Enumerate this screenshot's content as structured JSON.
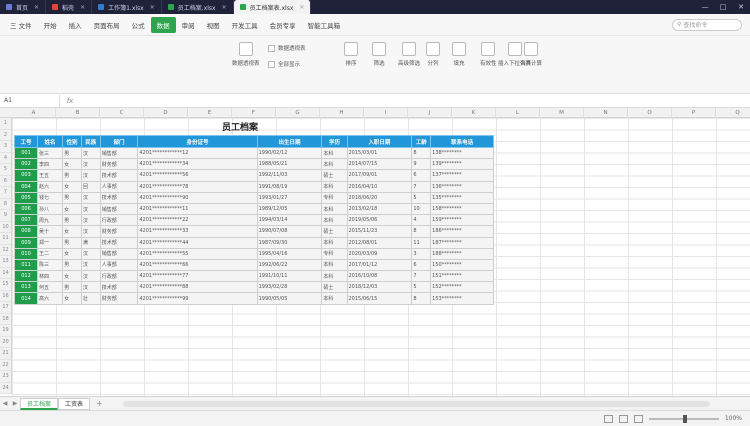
{
  "tabs": [
    {
      "label": "首页",
      "color": "#6b7bd6"
    },
    {
      "label": "稻壳",
      "color": "#e0463a"
    },
    {
      "label": "工作簿1.xlsx",
      "color": "#2b7cd3"
    },
    {
      "label": "员工档案.xlsx",
      "color": "#2ea44f"
    },
    {
      "label": "员工档案表.xlsx",
      "color": "#2ea44f",
      "active": true
    }
  ],
  "menu": [
    "三 文件",
    "开始",
    "插入",
    "页面布局",
    "公式",
    "数据",
    "审阅",
    "视图",
    "开发工具",
    "会员专享",
    "智能工具箱"
  ],
  "active_menu": "数据",
  "search_placeholder": "查找命令",
  "ribbon": {
    "buttons": [
      "数据透视表",
      "排序",
      "筛选",
      "高级筛选",
      "分列",
      "填充",
      "有效性",
      "插入下拉列表",
      "合并计算"
    ],
    "rows": [
      "数据透视表",
      "全部显示"
    ]
  },
  "namebox": "A1",
  "columns": [
    "A",
    "B",
    "C",
    "D",
    "E",
    "F",
    "G",
    "H",
    "I",
    "J",
    "K",
    "L",
    "M",
    "N",
    "O",
    "P",
    "Q"
  ],
  "rows": [
    "1",
    "2",
    "3",
    "4",
    "5",
    "6",
    "7",
    "8",
    "9",
    "10",
    "11",
    "12",
    "13",
    "14",
    "15",
    "16",
    "17",
    "18",
    "19",
    "20",
    "21",
    "22",
    "23",
    "24"
  ],
  "sheet_title": "员工档案",
  "table": {
    "headers": [
      "工号",
      "姓名",
      "性别",
      "民族",
      "部门",
      "身份证号",
      "出生日期",
      "学历",
      "入职日期",
      "工龄",
      "联系电话"
    ],
    "rows": [
      [
        "001",
        "张三",
        "男",
        "汉",
        "销售部",
        "4201************12",
        "1990/02/12",
        "本科",
        "2015/03/01",
        "8",
        "138********"
      ],
      [
        "002",
        "李四",
        "女",
        "汉",
        "财务部",
        "4201************34",
        "1988/05/21",
        "本科",
        "2014/07/15",
        "9",
        "139********"
      ],
      [
        "003",
        "王五",
        "男",
        "汉",
        "技术部",
        "4201************56",
        "1992/11/03",
        "硕士",
        "2017/09/01",
        "6",
        "137********"
      ],
      [
        "004",
        "赵六",
        "女",
        "回",
        "人事部",
        "4201************78",
        "1991/08/19",
        "本科",
        "2016/04/10",
        "7",
        "136********"
      ],
      [
        "005",
        "钱七",
        "男",
        "汉",
        "技术部",
        "4201************90",
        "1993/01/27",
        "专科",
        "2018/06/20",
        "5",
        "135********"
      ],
      [
        "006",
        "孙八",
        "女",
        "汉",
        "销售部",
        "4201************11",
        "1989/12/05",
        "本科",
        "2013/02/18",
        "10",
        "158********"
      ],
      [
        "007",
        "周九",
        "男",
        "汉",
        "行政部",
        "4201************22",
        "1994/03/14",
        "本科",
        "2019/05/06",
        "4",
        "159********"
      ],
      [
        "008",
        "吴十",
        "女",
        "汉",
        "财务部",
        "4201************33",
        "1990/07/08",
        "硕士",
        "2015/11/23",
        "8",
        "186********"
      ],
      [
        "009",
        "郑一",
        "男",
        "满",
        "技术部",
        "4201************44",
        "1987/09/30",
        "本科",
        "2012/08/01",
        "11",
        "187********"
      ],
      [
        "010",
        "王二",
        "女",
        "汉",
        "销售部",
        "4201************55",
        "1995/04/16",
        "专科",
        "2020/03/09",
        "3",
        "188********"
      ],
      [
        "011",
        "陈三",
        "男",
        "汉",
        "人事部",
        "4201************66",
        "1992/06/22",
        "本科",
        "2017/01/12",
        "6",
        "150********"
      ],
      [
        "012",
        "林四",
        "女",
        "汉",
        "行政部",
        "4201************77",
        "1991/10/11",
        "本科",
        "2016/10/08",
        "7",
        "151********"
      ],
      [
        "013",
        "何五",
        "男",
        "汉",
        "技术部",
        "4201************88",
        "1993/02/28",
        "硕士",
        "2018/12/03",
        "5",
        "152********"
      ],
      [
        "014",
        "高六",
        "女",
        "壮",
        "财务部",
        "4201************99",
        "1990/05/05",
        "本科",
        "2015/06/15",
        "8",
        "153********"
      ]
    ]
  },
  "sheets": [
    "员工档案",
    "工资表"
  ],
  "active_sheet": "员工档案",
  "status": {
    "left": "",
    "zoom": "100%"
  }
}
